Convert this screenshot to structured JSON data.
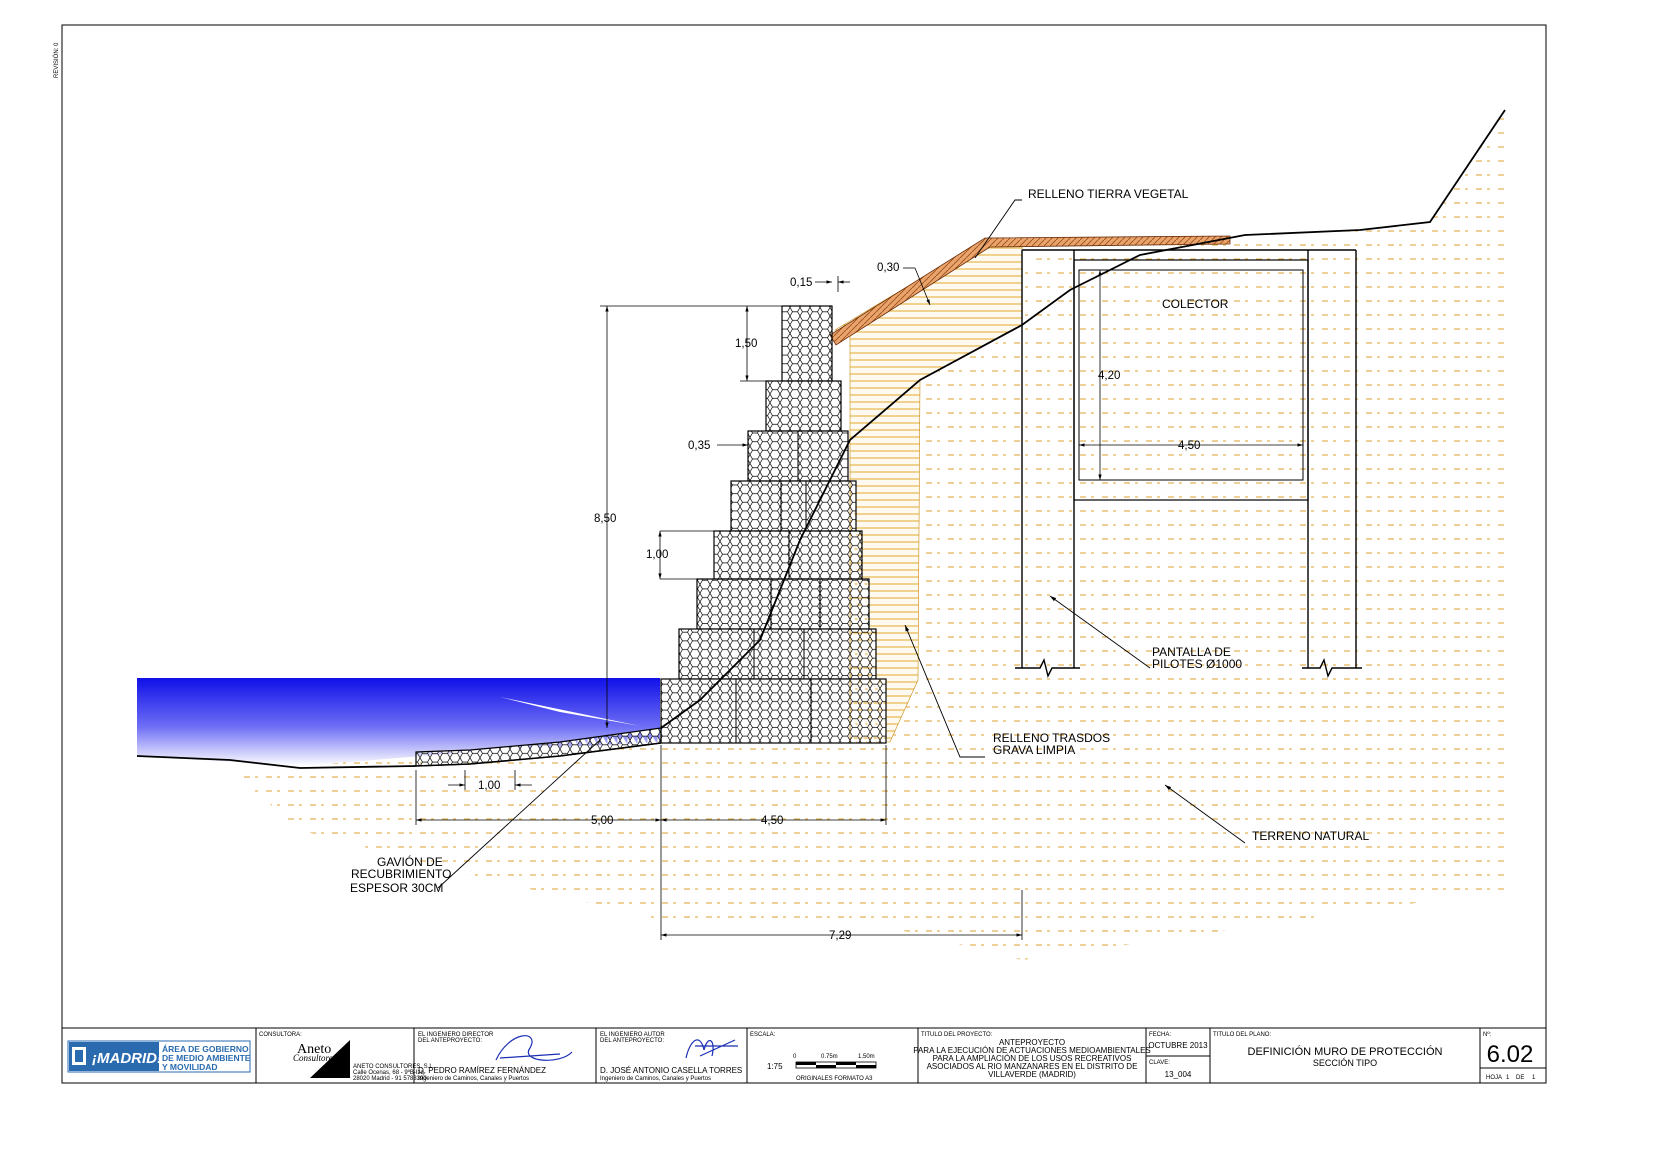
{
  "side_text": "REVISIÓN: 0",
  "labels": {
    "relleno_tierra_vegetal": "RELLENO TIERRA VEGETAL",
    "colector": "COLECTOR",
    "pantalla_line1": "PANTALLA DE",
    "pantalla_line2": "PILOTES Ø1000",
    "relleno_trasdos_line1": "RELLENO TRASDOS",
    "relleno_trasdos_line2": "GRAVA LIMPIA",
    "terreno_natural": "TERRENO NATURAL",
    "gavion_line1": "GAVIÓN DE",
    "gavion_line2": "RECUBRIMIENTO",
    "gavion_line3": "ESPESOR 30CM"
  },
  "dimensions": {
    "d015": "0,15",
    "d030": "0,30",
    "d150": "1,50",
    "d035": "0,35",
    "d850": "8,50",
    "d100_wall": "1,00",
    "d100_base": "1,00",
    "d500": "5,00",
    "d450_base": "4,50",
    "d729": "7,29",
    "d420": "4,20",
    "d450_colector": "4,50"
  },
  "title_block": {
    "logo_text": "¡MADRID!",
    "area_line1": "ÁREA DE GOBIERNO",
    "area_line2": "DE MEDIO AMBIENTE",
    "area_line3": "Y MOVILIDAD",
    "consultora_label": "CONSULTORA:",
    "consultora_name": "Aneto",
    "consultora_sub": "Consultores",
    "consultora_addr1": "ANETO CONSULTORES, S.L.",
    "consultora_addr2": "Calle Ocenas, 68 - 9ºB-Izq.",
    "consultora_addr3": "28020 Madrid - 91 5783390",
    "director_label1": "EL INGENIERO DIRECTOR",
    "director_label2": "DEL ANTEPROYECTO:",
    "director_name": "D. PEDRO RAMÍREZ FERNÁNDEZ",
    "director_title": "Ingeniero de Caminos, Canales y Puertos",
    "autor_label1": "EL INGENIERO AUTOR",
    "autor_label2": "DEL ANTEPROYECTO:",
    "autor_name": "D. JOSÉ ANTONIO CASELLA TORRES",
    "autor_title": "Ingeniero de Caminos, Canales y Puertos",
    "escala_label": "ESCALA:",
    "escala_value": "1:75",
    "escala_0": "0",
    "escala_mid": "0.75m",
    "escala_end": "1.50m",
    "originales": "ORIGINALES FORMATO A3",
    "titulo_proyecto_label": "TITULO DEL PROYECTO:",
    "proyecto_line1": "ANTEPROYECTO",
    "proyecto_line2": "PARA LA EJECUCIÓN DE ACTUACIONES MEDIOAMBIENTALES",
    "proyecto_line3": "PARA LA AMPLIACIÓN DE LOS USOS RECREATIVOS",
    "proyecto_line4": "ASOCIADOS AL RIO MANZANARES EN EL DISTRITO DE",
    "proyecto_line5": "VILLAVERDE (MADRID)",
    "fecha_label": "FECHA:",
    "fecha_value": "OCTUBRE 2013",
    "clave_label": "CLAVE:",
    "clave_value": "13_004",
    "titulo_plano_label": "TITULO DEL PLANO:",
    "plano_line1": "DEFINICIÓN MURO DE PROTECCIÓN",
    "plano_line2": "SECCIÓN TIPO",
    "numero_label": "Nº:",
    "numero_value": "6.02",
    "hoja_label": "HOJA",
    "hoja_value": "1",
    "de_label": "DE",
    "de_value": "1"
  }
}
